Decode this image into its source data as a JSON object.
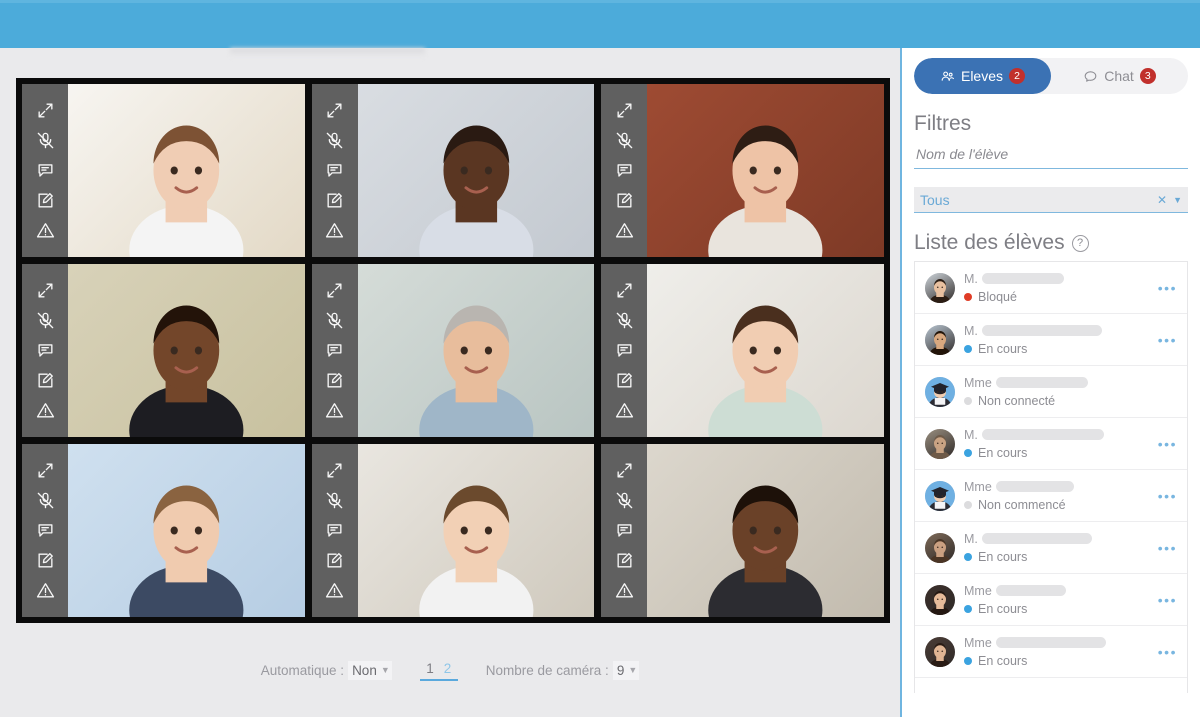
{
  "app_bar": {
    "color": "#4cabda"
  },
  "stage": {
    "grid": {
      "rows": 3,
      "cols": 3,
      "tile_tools": [
        {
          "name": "expand-icon",
          "label": "Plein écran"
        },
        {
          "name": "mic-muted-icon",
          "label": "Micro coupé"
        },
        {
          "name": "chat-bubble-icon",
          "label": "Message"
        },
        {
          "name": "edit-pencil-icon",
          "label": "Annoter"
        },
        {
          "name": "warning-triangle-icon",
          "label": "Signaler"
        }
      ],
      "tiles": [
        {
          "id": 1,
          "skin": "#f0cdb4",
          "hair": "#7d5234",
          "shirt": "#f4f4f4",
          "bg1": "#f7f5f1",
          "bg2": "#e3d9c6"
        },
        {
          "id": 2,
          "skin": "#5a3622",
          "hair": "#2a1a12",
          "shirt": "#d8dde6",
          "bg1": "#d9dde2",
          "bg2": "#c3c9d0"
        },
        {
          "id": 3,
          "skin": "#eec3a6",
          "hair": "#2e1d14",
          "shirt": "#e9e4dd",
          "bg1": "#9e4b33",
          "bg2": "#7e3a26"
        },
        {
          "id": 4,
          "skin": "#73462a",
          "hair": "#231309",
          "shirt": "#1d1d22",
          "bg1": "#d8d2b9",
          "bg2": "#c8c19f"
        },
        {
          "id": 5,
          "skin": "#e8bd9c",
          "hair": "#b9b5b0",
          "shirt": "#9fb6c8",
          "bg1": "#d5dcd8",
          "bg2": "#b9c5c2"
        },
        {
          "id": 6,
          "skin": "#f1cdb2",
          "hair": "#4a2f1e",
          "shirt": "#cdddd4",
          "bg1": "#efeeea",
          "bg2": "#dcd7cf"
        },
        {
          "id": 7,
          "skin": "#f0cbaf",
          "hair": "#8a6340",
          "shirt": "#3c4a63",
          "bg1": "#cfe0ef",
          "bg2": "#b6cde3"
        },
        {
          "id": 8,
          "skin": "#f2d0b5",
          "hair": "#6b4a2d",
          "shirt": "#f2f2f2",
          "bg1": "#e9e6e0",
          "bg2": "#cfc9bd"
        },
        {
          "id": 9,
          "skin": "#6a4128",
          "hair": "#1d1109",
          "shirt": "#2c2c31",
          "bg1": "#dcd7cd",
          "bg2": "#c2bbae"
        }
      ]
    },
    "controls": {
      "auto_label": "Automatique :",
      "auto_value": "Non",
      "camera_label": "Nombre de caméra :",
      "camera_value": "9",
      "pages": [
        {
          "label": "1",
          "active": true
        },
        {
          "label": "2",
          "active": false
        }
      ]
    }
  },
  "side_panel": {
    "tabs": [
      {
        "id": "eleves",
        "label": "Eleves",
        "badge": "2",
        "icon": "people-icon",
        "active": true
      },
      {
        "id": "chat",
        "label": "Chat",
        "badge": "3",
        "icon": "chat-bubble-icon",
        "active": false
      }
    ],
    "filters_title": "Filtres",
    "name_filter_placeholder": "Nom de l'élève",
    "name_filter_value": "",
    "type_filter_value": "Tous",
    "list_title": "Liste des élèves",
    "help_glyph": "?",
    "kebab_glyph": "•••",
    "status_colors": {
      "bloque": "#e03c26",
      "en_cours": "#3ba3e0",
      "inactif": "#dcdcde"
    },
    "students": [
      {
        "title": "M.",
        "name_width": 82,
        "status": "Bloqué",
        "status_key": "bloque",
        "has_menu": true,
        "avatar": "photo",
        "skin": "#e8c0a0",
        "hair": "#2b1d14",
        "bg": "#cfd6dc"
      },
      {
        "title": "M.",
        "name_width": 120,
        "status": "En cours",
        "status_key": "en_cours",
        "has_menu": true,
        "avatar": "photo",
        "skin": "#d8a87f",
        "hair": "#221409",
        "bg": "#b9c6d2"
      },
      {
        "title": "Mme",
        "name_width": 92,
        "status": "Non connecté",
        "status_key": "inactif",
        "has_menu": false,
        "avatar": "graduate",
        "skin": "#f0cdb0",
        "hair": "#2b2b33",
        "bg": "#6fb0e2"
      },
      {
        "title": "M.",
        "name_width": 122,
        "status": "En cours",
        "status_key": "en_cours",
        "has_menu": true,
        "avatar": "photo",
        "skin": "#c9a383",
        "hair": "#6e5a48",
        "bg": "#9a8f80"
      },
      {
        "title": "Mme",
        "name_width": 78,
        "status": "Non commencé",
        "status_key": "inactif",
        "has_menu": true,
        "avatar": "graduate",
        "skin": "#f0cdb0",
        "hair": "#2b2b33",
        "bg": "#6fb0e2"
      },
      {
        "title": "M.",
        "name_width": 110,
        "status": "En cours",
        "status_key": "en_cours",
        "has_menu": true,
        "avatar": "photo",
        "skin": "#caa081",
        "hair": "#4a3525",
        "bg": "#7e6a58"
      },
      {
        "title": "Mme",
        "name_width": 70,
        "status": "En cours",
        "status_key": "en_cours",
        "has_menu": true,
        "avatar": "photo",
        "skin": "#e6bb9a",
        "hair": "#241812",
        "bg": "#3b2f2a"
      },
      {
        "title": "Mme",
        "name_width": 110,
        "status": "En cours",
        "status_key": "en_cours",
        "has_menu": true,
        "avatar": "photo",
        "skin": "#e0b594",
        "hair": "#2a1c15",
        "bg": "#4a3c36"
      }
    ]
  }
}
